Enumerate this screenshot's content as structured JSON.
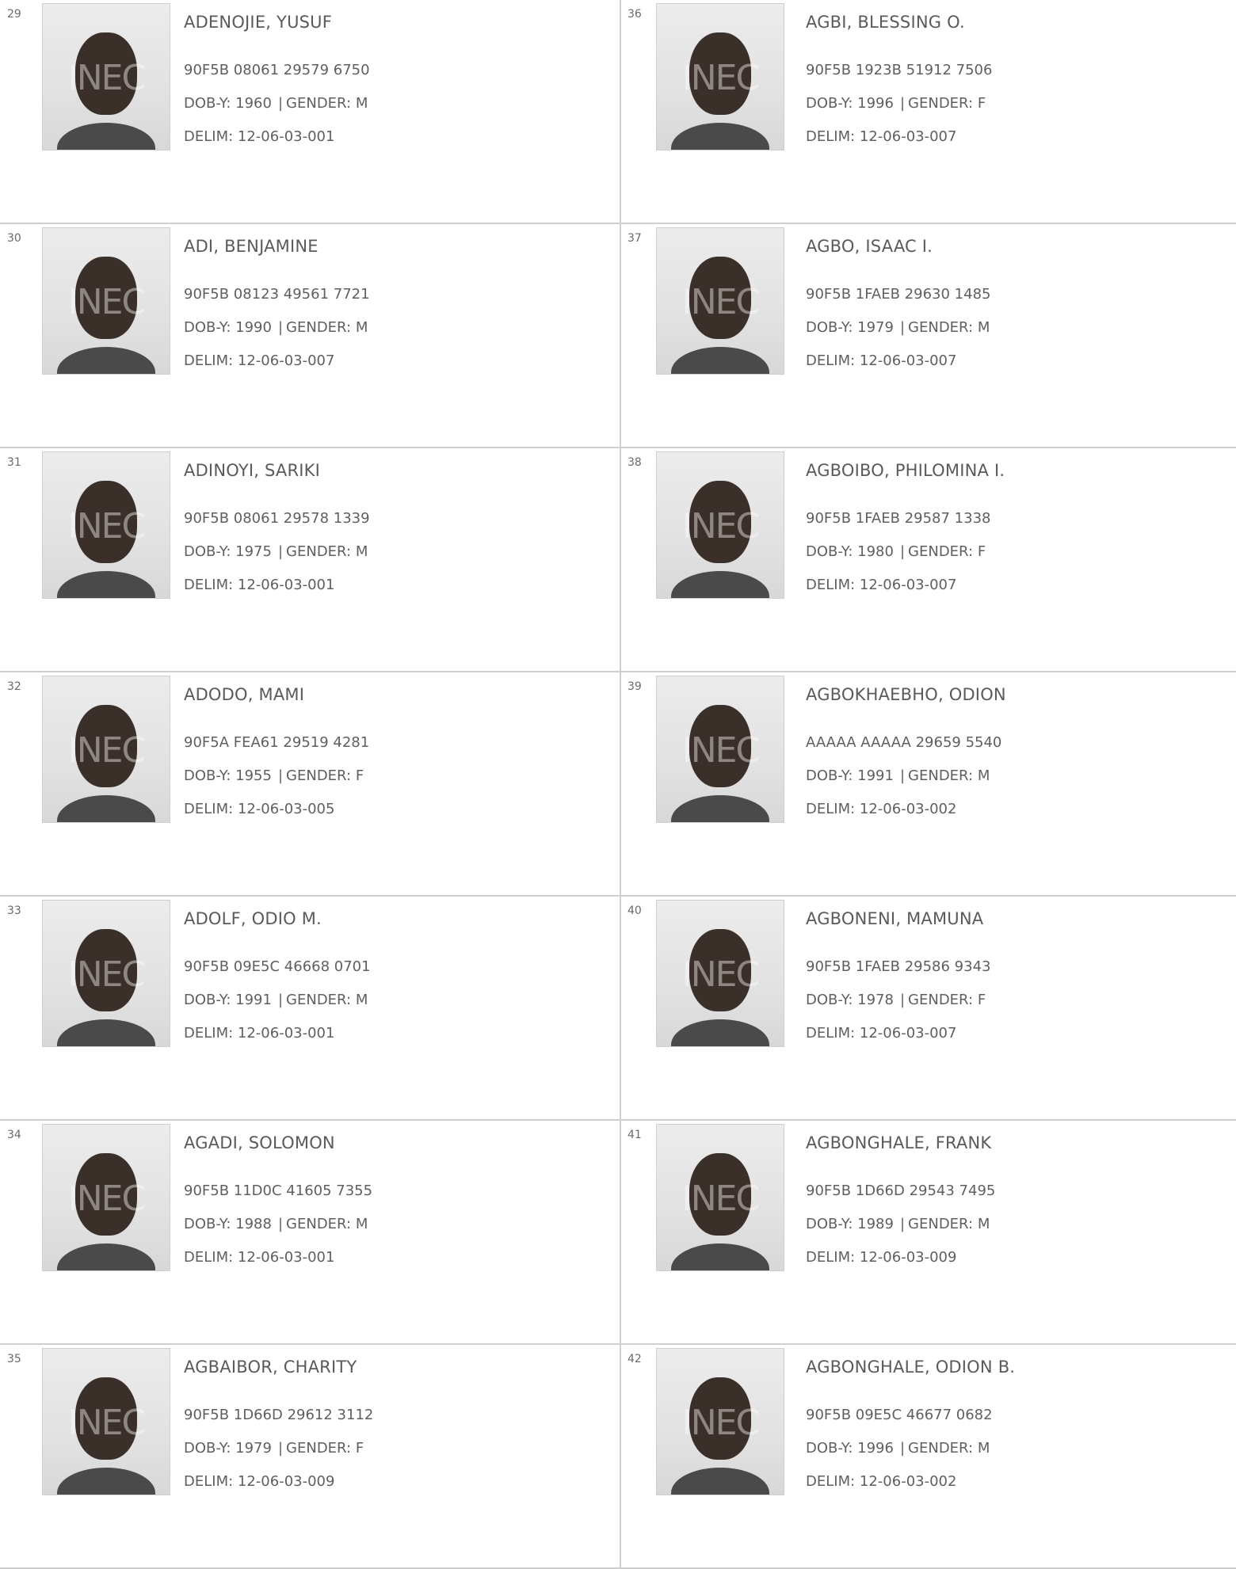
{
  "register": {
    "watermark_text": "INEC",
    "dob_prefix": "DOB-Y:",
    "gender_prefix": "GENDER:",
    "delim_prefix": "DELIM:",
    "separator": "|",
    "voters": [
      {
        "serial": "29",
        "name": "ADENOJIE, YUSUF",
        "vin": "90F5B 08061 29579 6750",
        "dob_year": "1960",
        "gender": "M",
        "delim": "12-06-03-001"
      },
      {
        "serial": "36",
        "name": "AGBI, BLESSING O.",
        "vin": "90F5B 1923B 51912 7506",
        "dob_year": "1996",
        "gender": "F",
        "delim": "12-06-03-007"
      },
      {
        "serial": "30",
        "name": "ADI, BENJAMINE",
        "vin": "90F5B 08123 49561 7721",
        "dob_year": "1990",
        "gender": "M",
        "delim": "12-06-03-007"
      },
      {
        "serial": "37",
        "name": "AGBO, ISAAC I.",
        "vin": "90F5B 1FAEB 29630 1485",
        "dob_year": "1979",
        "gender": "M",
        "delim": "12-06-03-007"
      },
      {
        "serial": "31",
        "name": "ADINOYI, SARIKI",
        "vin": "90F5B 08061 29578 1339",
        "dob_year": "1975",
        "gender": "M",
        "delim": "12-06-03-001"
      },
      {
        "serial": "38",
        "name": "AGBOIBO, PHILOMINA I.",
        "vin": "90F5B 1FAEB 29587 1338",
        "dob_year": "1980",
        "gender": "F",
        "delim": "12-06-03-007"
      },
      {
        "serial": "32",
        "name": "ADODO, MAMI",
        "vin": "90F5A FEA61 29519 4281",
        "dob_year": "1955",
        "gender": "F",
        "delim": "12-06-03-005"
      },
      {
        "serial": "39",
        "name": "AGBOKHAEBHO, ODION",
        "vin": "AAAAA AAAAA 29659 5540",
        "dob_year": "1991",
        "gender": "M",
        "delim": "12-06-03-002"
      },
      {
        "serial": "33",
        "name": "ADOLF, ODIO M.",
        "vin": "90F5B 09E5C 46668 0701",
        "dob_year": "1991",
        "gender": "M",
        "delim": "12-06-03-001"
      },
      {
        "serial": "40",
        "name": "AGBONENI, MAMUNA",
        "vin": "90F5B 1FAEB 29586 9343",
        "dob_year": "1978",
        "gender": "F",
        "delim": "12-06-03-007"
      },
      {
        "serial": "34",
        "name": "AGADI, SOLOMON",
        "vin": "90F5B 11D0C 41605 7355",
        "dob_year": "1988",
        "gender": "M",
        "delim": "12-06-03-001"
      },
      {
        "serial": "41",
        "name": "AGBONGHALE, FRANK",
        "vin": "90F5B 1D66D 29543 7495",
        "dob_year": "1989",
        "gender": "M",
        "delim": "12-06-03-009"
      },
      {
        "serial": "35",
        "name": "AGBAIBOR, CHARITY",
        "vin": "90F5B 1D66D 29612 3112",
        "dob_year": "1979",
        "gender": "F",
        "delim": "12-06-03-009"
      },
      {
        "serial": "42",
        "name": "AGBONGHALE, ODION B.",
        "vin": "90F5B 09E5C 46677 0682",
        "dob_year": "1996",
        "gender": "M",
        "delim": "12-06-03-002"
      }
    ]
  }
}
